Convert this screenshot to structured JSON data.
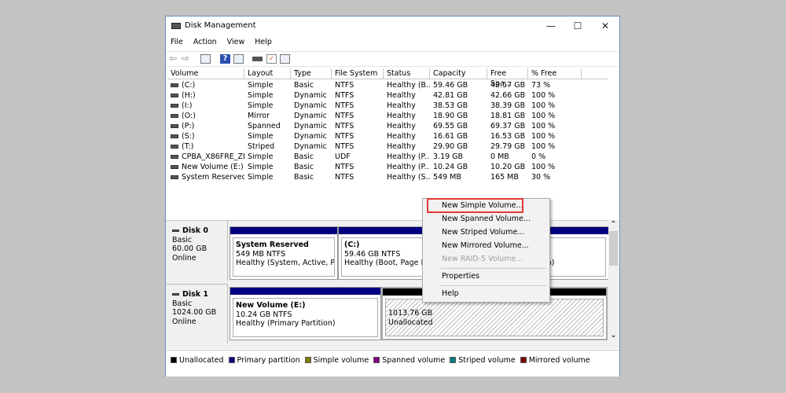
{
  "window": {
    "title": "Disk Management",
    "minimize": "—",
    "maximize": "☐",
    "close": "✕"
  },
  "menu": [
    "File",
    "Action",
    "View",
    "Help"
  ],
  "toolbar": [
    "back-icon",
    "forward-icon",
    "console-tree-icon",
    "help-icon",
    "action-pane-icon",
    "connect-icon",
    "check-icon",
    "properties-icon"
  ],
  "columns": [
    "Volume",
    "Layout",
    "Type",
    "File System",
    "Status",
    "Capacity",
    "Free Spa...",
    "% Free"
  ],
  "rows": [
    [
      "(C:)",
      "Simple",
      "Basic",
      "NTFS",
      "Healthy (B...",
      "59.46 GB",
      "43.57 GB",
      "73 %"
    ],
    [
      "(H:)",
      "Simple",
      "Dynamic",
      "NTFS",
      "Healthy",
      "42.81 GB",
      "42.66 GB",
      "100 %"
    ],
    [
      "(I:)",
      "Simple",
      "Dynamic",
      "NTFS",
      "Healthy",
      "38.53 GB",
      "38.39 GB",
      "100 %"
    ],
    [
      "(O:)",
      "Mirror",
      "Dynamic",
      "NTFS",
      "Healthy",
      "18.90 GB",
      "18.81 GB",
      "100 %"
    ],
    [
      "(P:)",
      "Spanned",
      "Dynamic",
      "NTFS",
      "Healthy",
      "69.55 GB",
      "69.37 GB",
      "100 %"
    ],
    [
      "(S:)",
      "Simple",
      "Dynamic",
      "NTFS",
      "Healthy",
      "16.61 GB",
      "16.53 GB",
      "100 %"
    ],
    [
      "(T:)",
      "Striped",
      "Dynamic",
      "NTFS",
      "Healthy",
      "29.90 GB",
      "29.79 GB",
      "100 %"
    ],
    [
      "CPBA_X86FRE_ZH...",
      "Simple",
      "Basic",
      "UDF",
      "Healthy (P...",
      "3.19 GB",
      "0 MB",
      "0 %"
    ],
    [
      "New Volume (E:)",
      "Simple",
      "Basic",
      "NTFS",
      "Healthy (P...",
      "10.24 GB",
      "10.20 GB",
      "100 %"
    ],
    [
      "System Reserved",
      "Simple",
      "Basic",
      "NTFS",
      "Healthy (S...",
      "549 MB",
      "165 MB",
      "30 %"
    ]
  ],
  "disks": [
    {
      "name": "Disk 0",
      "type": "Basic",
      "size": "60.00 GB",
      "state": "Online",
      "parts": [
        {
          "title": "System Reserved",
          "size": "549 MB NTFS",
          "status": "Healthy (System, Active, Primary Partition)"
        },
        {
          "title": "(C:)",
          "size": "59.46 GB NTFS",
          "status": "Healthy (Boot, Page File, Crash Dump, Primary Partition)"
        }
      ]
    },
    {
      "name": "Disk 1",
      "type": "Basic",
      "size": "1024.00 GB",
      "state": "Online",
      "parts": [
        {
          "title": "New Volume  (E:)",
          "size": "10.24 GB NTFS",
          "status": "Healthy (Primary Partition)"
        },
        {
          "size": "1013.76 GB",
          "status": "Unallocated"
        }
      ]
    }
  ],
  "legend": [
    {
      "label": "Unallocated",
      "color": "#000000"
    },
    {
      "label": "Primary partition",
      "color": "#000080"
    },
    {
      "label": "Simple volume",
      "color": "#808000"
    },
    {
      "label": "Spanned volume",
      "color": "#800080"
    },
    {
      "label": "Striped volume",
      "color": "#008080"
    },
    {
      "label": "Mirrored volume",
      "color": "#800000"
    }
  ],
  "context_menu": {
    "items": [
      "New Simple Volume...",
      "New Spanned Volume...",
      "New Striped Volume...",
      "New Mirrored Volume...",
      "New RAID-5 Volume...",
      "Properties",
      "Help"
    ],
    "disabled": "New RAID-5 Volume...",
    "highlighted": "New Simple Volume...",
    "highlight_color": "#e53935"
  },
  "scroll": {
    "up": "⌃",
    "down": "⌄"
  }
}
